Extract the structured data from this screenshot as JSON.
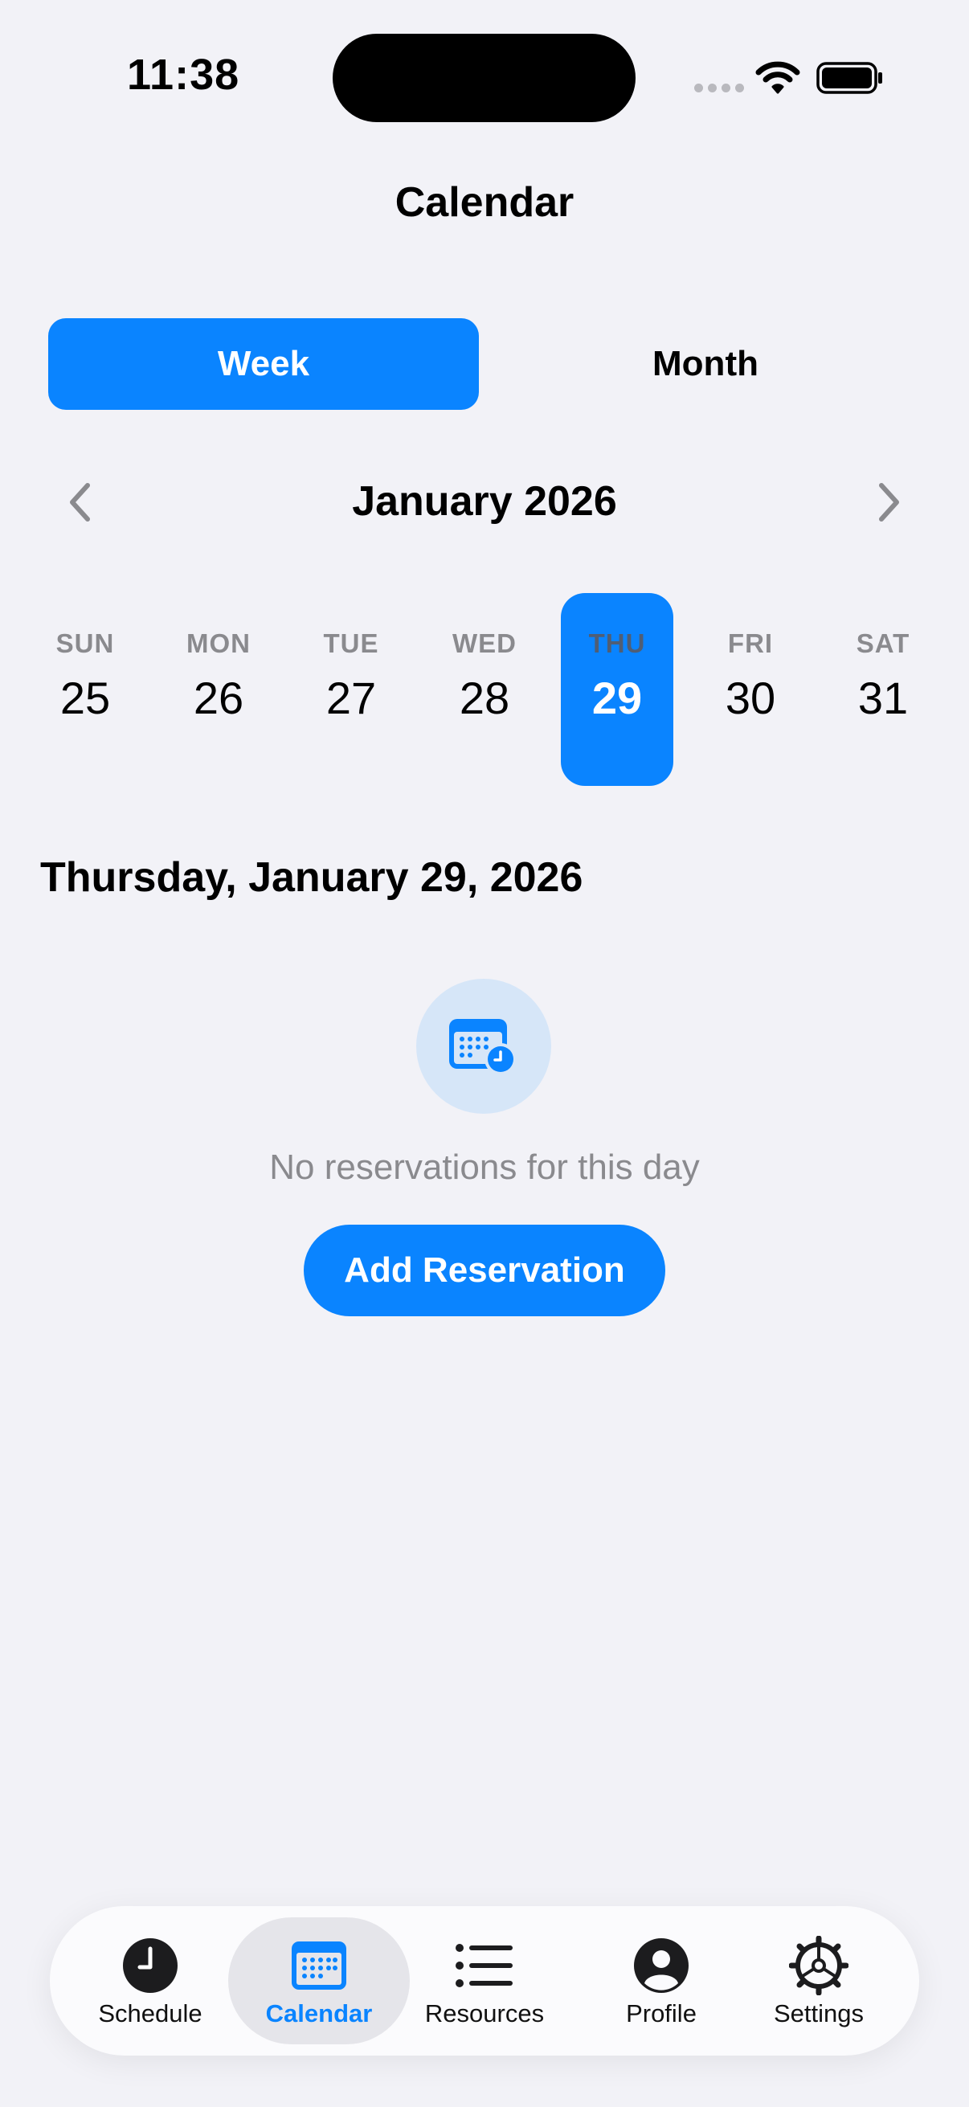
{
  "status_bar": {
    "time": "11:38"
  },
  "nav": {
    "title": "Calendar"
  },
  "segmented": {
    "week_label": "Week",
    "month_label": "Month",
    "selected": "Week"
  },
  "month_nav": {
    "label": "January 2026"
  },
  "week": {
    "days": [
      {
        "dow": "SUN",
        "num": "25"
      },
      {
        "dow": "MON",
        "num": "26"
      },
      {
        "dow": "TUE",
        "num": "27"
      },
      {
        "dow": "WED",
        "num": "28"
      },
      {
        "dow": "THU",
        "num": "29"
      },
      {
        "dow": "FRI",
        "num": "30"
      },
      {
        "dow": "SAT",
        "num": "31"
      }
    ],
    "selected_index": 4
  },
  "selected_date": {
    "heading": "Thursday, January 29, 2026"
  },
  "empty_state": {
    "icon": "calendar-clock-icon",
    "message": "No reservations for this day",
    "button_label": "Add Reservation"
  },
  "tabbar": {
    "items": [
      {
        "label": "Schedule",
        "icon": "clock-icon"
      },
      {
        "label": "Calendar",
        "icon": "calendar-icon"
      },
      {
        "label": "Resources",
        "icon": "list-icon"
      },
      {
        "label": "Profile",
        "icon": "person-icon"
      },
      {
        "label": "Settings",
        "icon": "gear-icon"
      }
    ],
    "active": "Calendar"
  },
  "colors": {
    "accent": "#0A84FF",
    "background": "#F2F2F7",
    "secondary_text": "#8A8A8E"
  }
}
